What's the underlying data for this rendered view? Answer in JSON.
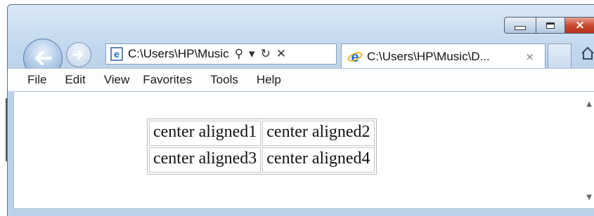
{
  "window": {
    "caption_buttons": {
      "minimize": "minimize",
      "maximize": "maximize",
      "close": "×"
    }
  },
  "navigation": {
    "address": "C:\\Users\\HP\\Music",
    "search_glyph": "⚲",
    "dropdown_glyph": "▾",
    "refresh_glyph": "↻",
    "stop_glyph": "✕"
  },
  "tab": {
    "title": "C:\\Users\\HP\\Music\\D...",
    "close": "×"
  },
  "menu": [
    "File",
    "Edit",
    "View",
    "Favorites",
    "Tools",
    "Help"
  ],
  "table": {
    "rows": [
      [
        "center aligned1",
        "center aligned2"
      ],
      [
        "center aligned3",
        "center aligned4"
      ]
    ]
  },
  "colors": {
    "chrome": "#c3d8ee",
    "close_button": "#c6452c",
    "ie_icon": "#1e6fd0"
  }
}
